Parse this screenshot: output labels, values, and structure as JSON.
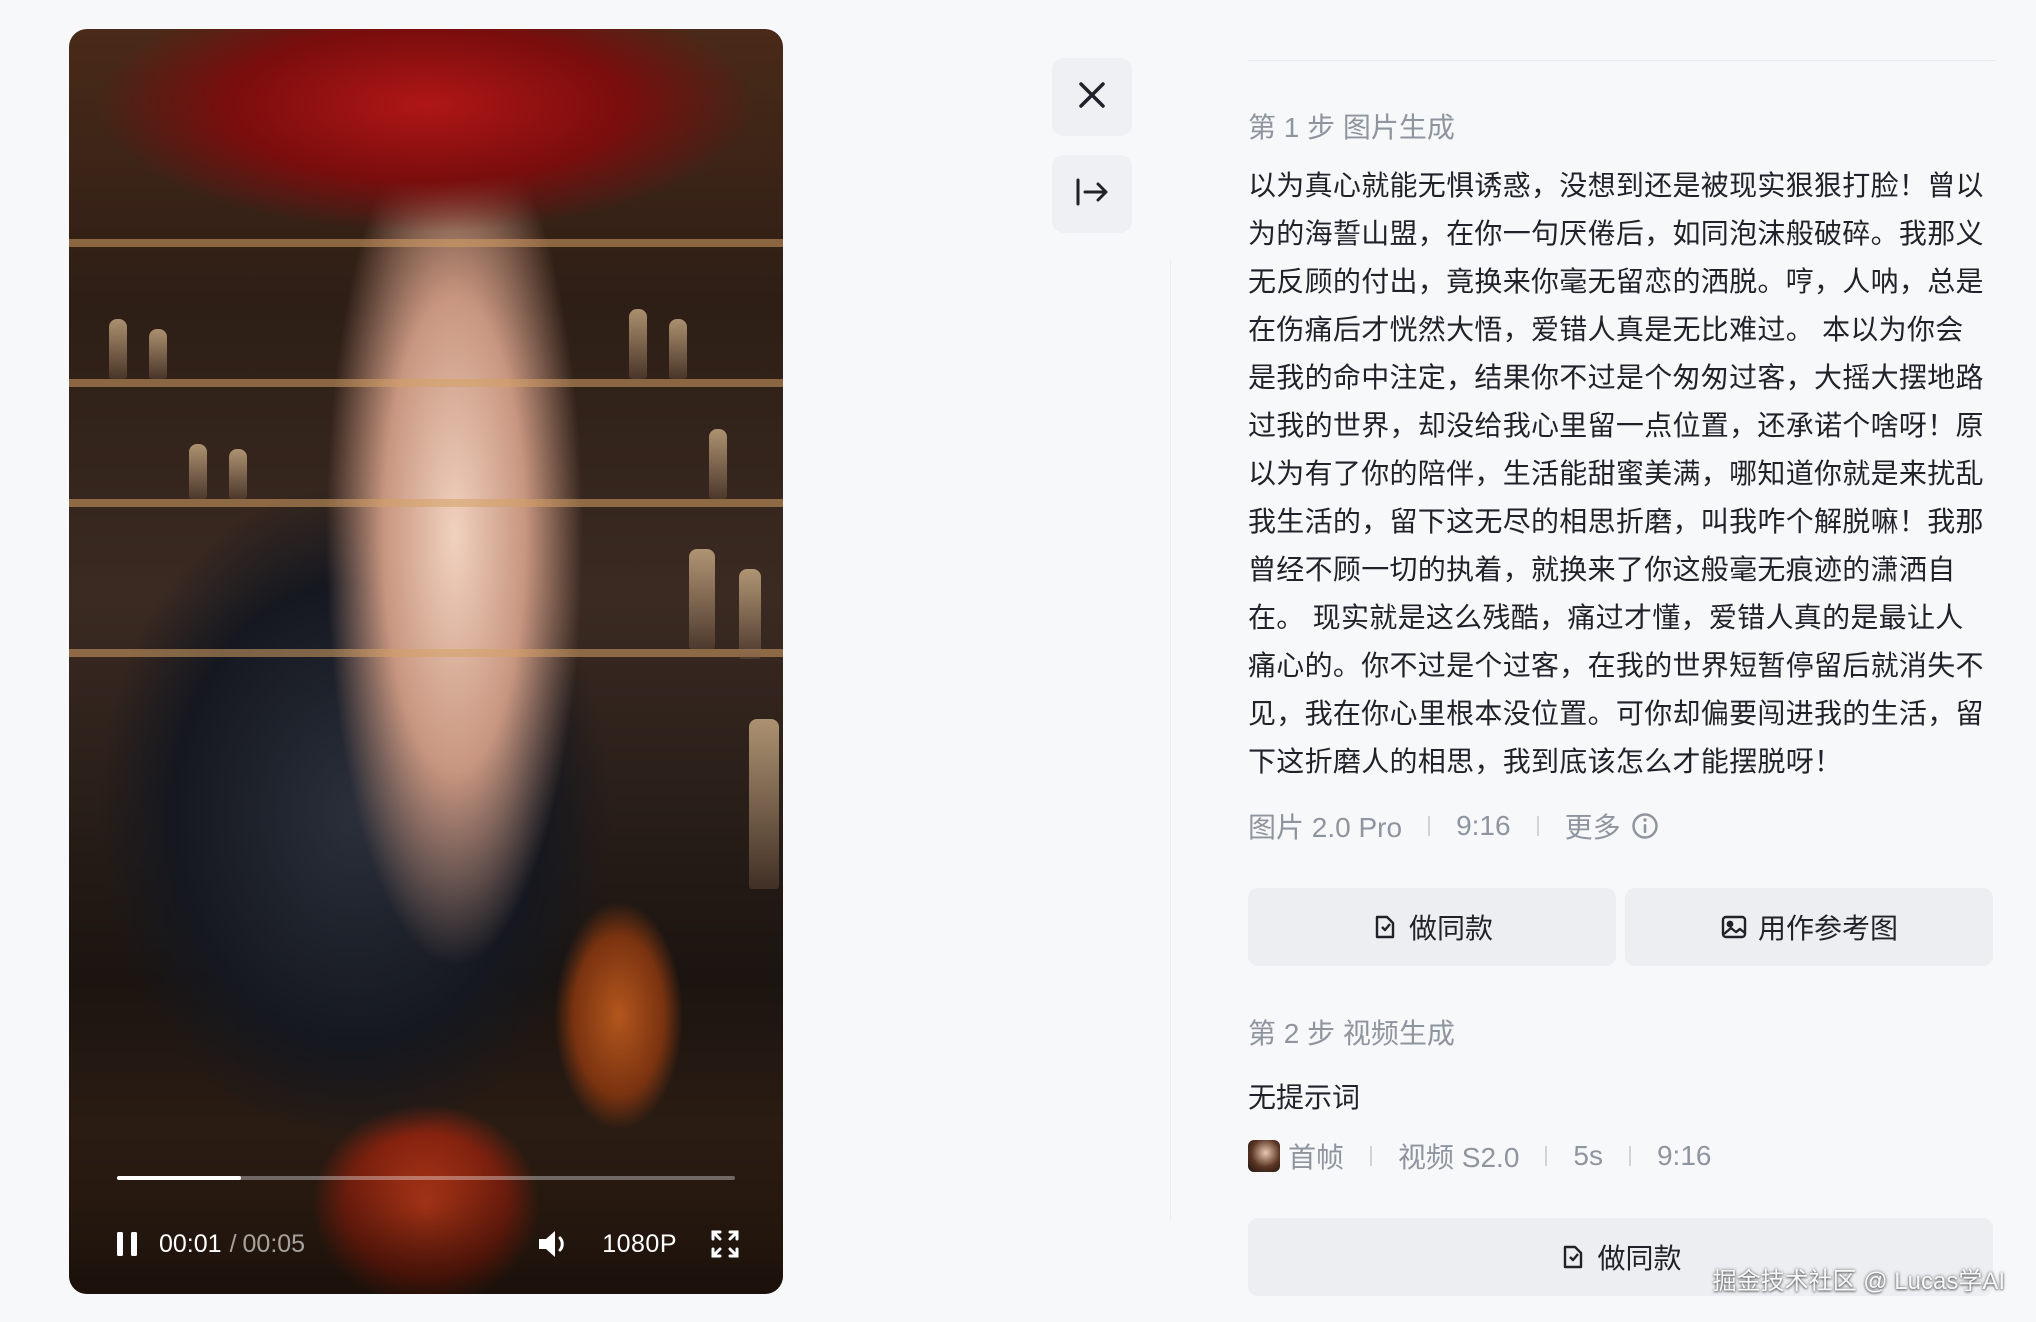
{
  "player": {
    "time_current": "00:01",
    "time_separator": "/",
    "time_total": "00:05",
    "quality": "1080P",
    "progress_fraction": 0.2,
    "icons": {
      "pause": "pause-icon",
      "volume": "volume-icon",
      "fullscreen": "fullscreen-icon"
    }
  },
  "side_buttons": {
    "close_icon": "close-icon",
    "collapse_icon": "collapse-right-icon"
  },
  "step1": {
    "title": "第 1 步 图片生成",
    "prompt": "以为真心就能无惧诱惑，没想到还是被现实狠狠打脸！曾以为的海誓山盟，在你一句厌倦后，如同泡沫般破碎。我那义无反顾的付出，竟换来你毫无留恋的洒脱。哼，人呐，总是在伤痛后才恍然大悟，爱错人真是无比难过。 本以为你会是我的命中注定，结果你不过是个匆匆过客，大摇大摆地路过我的世界，却没给我心里留一点位置，还承诺个啥呀！原以为有了你的陪伴，生活能甜蜜美满，哪知道你就是来扰乱我生活的，留下这无尽的相思折磨，叫我咋个解脱嘛！我那曾经不顾一切的执着，就换来了你这般毫无痕迹的潇洒自在。 现实就是这么残酷，痛过才懂，爱错人真的是最让人痛心的。你不过是个过客，在我的世界短暂停留后就消失不见，我在你心里根本没位置。可你却偏要闯进我的生活，留下这折磨人的相思，我到底该怎么才能摆脱呀！",
    "meta": {
      "model": "图片 2.0 Pro",
      "ratio": "9:16",
      "more": "更多"
    },
    "buttons": {
      "same_style": "做同款",
      "use_as_reference": "用作参考图"
    }
  },
  "step2": {
    "title": "第 2 步 视频生成",
    "prompt": "无提示词",
    "meta": {
      "first_frame": "首帧",
      "model": "视频 S2.0",
      "duration": "5s",
      "ratio": "9:16"
    },
    "buttons": {
      "same_style": "做同款"
    }
  },
  "watermark": "掘金技术社区 @ Lucas学AI",
  "colors": {
    "page_bg": "#f7f8fa",
    "button_bg": "#eceef1",
    "muted_text": "#8f959e",
    "primary_text": "#1f2329"
  }
}
